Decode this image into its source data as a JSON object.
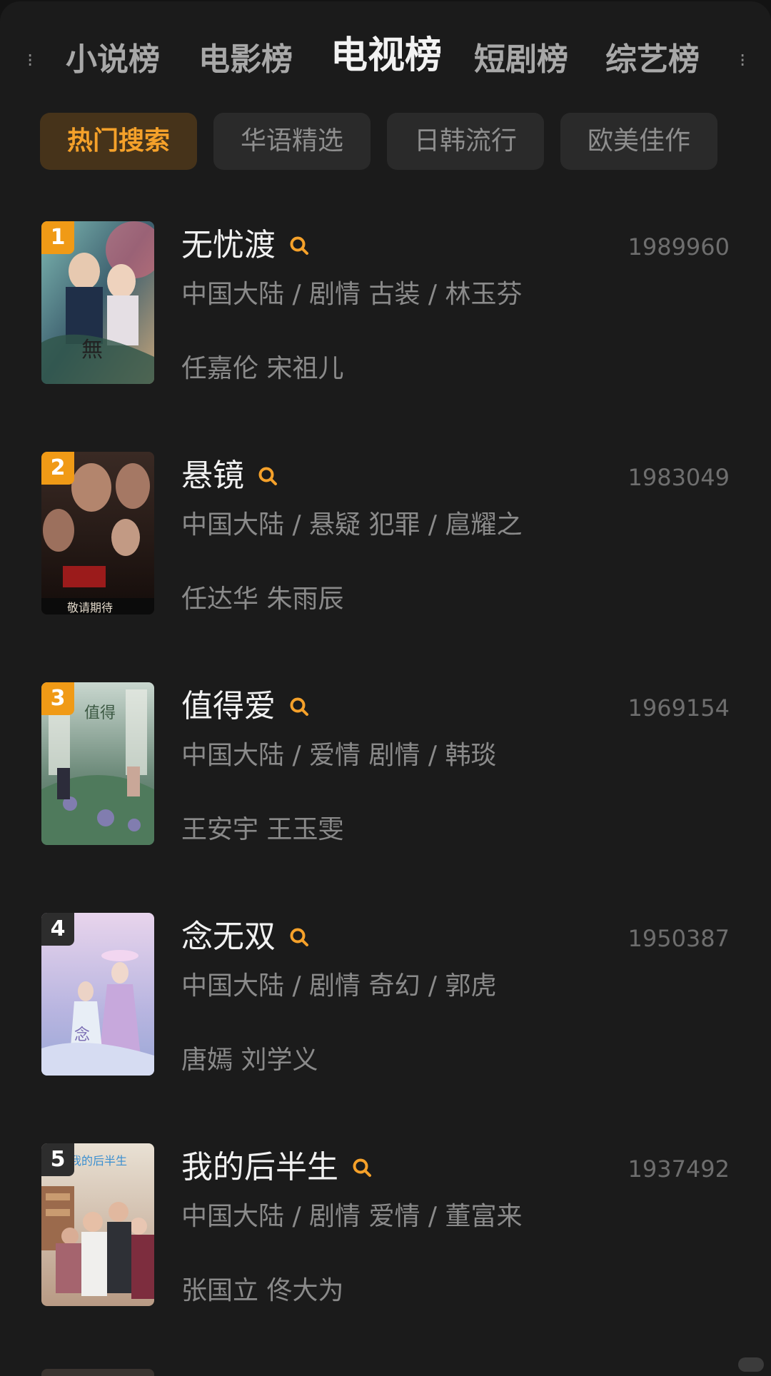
{
  "category_tabs": [
    {
      "label": "小说榜"
    },
    {
      "label": "电影榜"
    },
    {
      "label": "电视榜"
    },
    {
      "label": "短剧榜"
    },
    {
      "label": "综艺榜"
    }
  ],
  "active_category": "电视榜",
  "filter_chips": [
    {
      "label": "热门搜索"
    },
    {
      "label": "华语精选"
    },
    {
      "label": "日韩流行"
    },
    {
      "label": "欧美佳作"
    }
  ],
  "active_filter": "热门搜索",
  "items": [
    {
      "rank": "1",
      "title": "无忧渡",
      "score": "1989960",
      "meta": "中国大陆 / 剧情 古装 / 林玉芬",
      "cast": "任嘉伦 宋祖儿"
    },
    {
      "rank": "2",
      "title": "悬镜",
      "score": "1983049",
      "meta": "中国大陆 / 悬疑 犯罪 / 扈耀之",
      "cast": "任达华 朱雨辰"
    },
    {
      "rank": "3",
      "title": "值得爱",
      "score": "1969154",
      "meta": "中国大陆 / 爱情 剧情 / 韩琰",
      "cast": "王安宇 王玉雯"
    },
    {
      "rank": "4",
      "title": "念无双",
      "score": "1950387",
      "meta": "中国大陆 / 剧情 奇幻 / 郭虎",
      "cast": "唐嫣 刘学义"
    },
    {
      "rank": "5",
      "title": "我的后半生",
      "score": "1937492",
      "meta": "中国大陆 / 剧情 爱情 / 董富来",
      "cast": "张国立 佟大为"
    }
  ],
  "colors": {
    "accent": "#f5a12a",
    "rank_top": "#f09a16",
    "rank_other": "#2d2d2d",
    "background": "#1b1b1b"
  }
}
